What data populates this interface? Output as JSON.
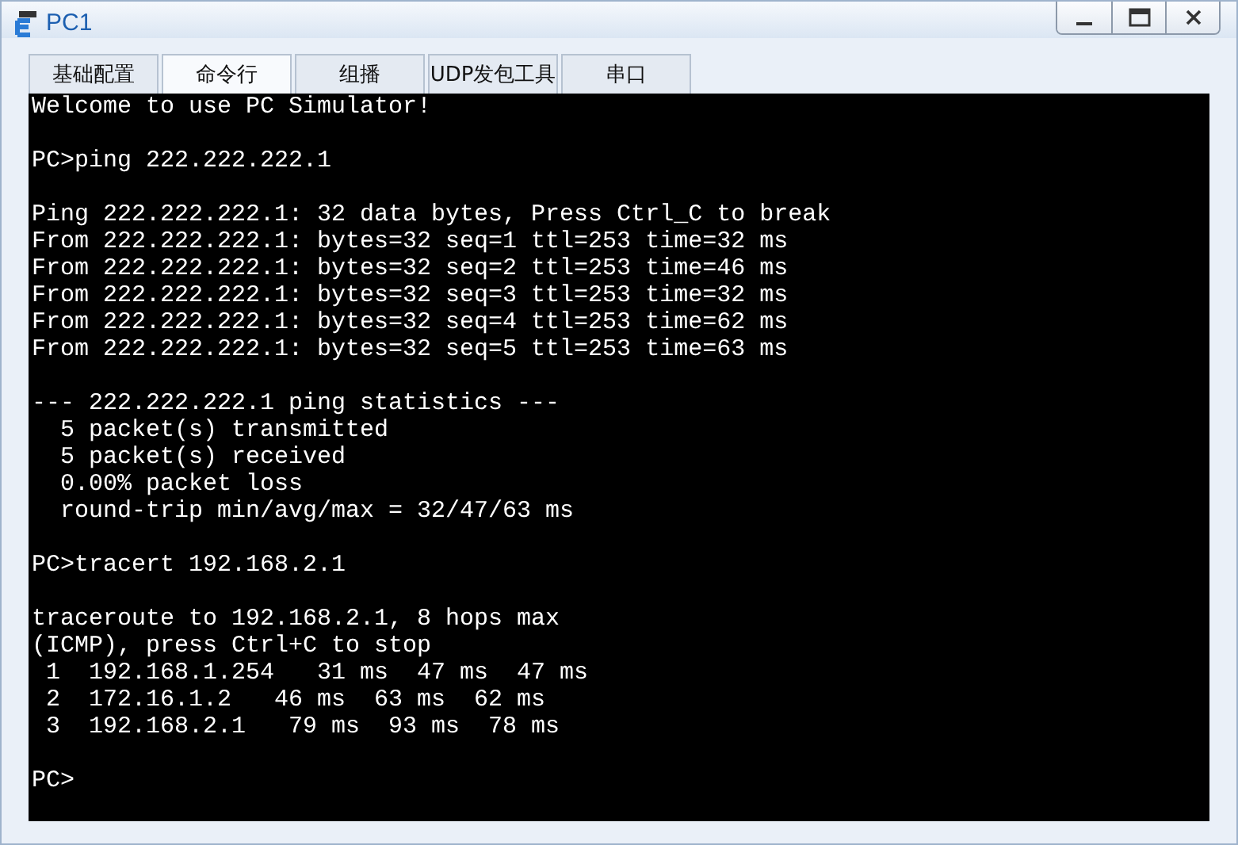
{
  "window": {
    "title": "PC1"
  },
  "tabs": [
    {
      "label": "基础配置",
      "selected": false
    },
    {
      "label": "命令行",
      "selected": true
    },
    {
      "label": "组播",
      "selected": false
    },
    {
      "label": "UDP发包工具",
      "selected": false
    },
    {
      "label": "串口",
      "selected": false
    }
  ],
  "terminal": {
    "blocks": [
      [
        "Welcome to use PC Simulator!"
      ],
      [
        "PC>ping 222.222.222.1"
      ],
      [
        "Ping 222.222.222.1: 32 data bytes, Press Ctrl_C to break",
        "From 222.222.222.1: bytes=32 seq=1 ttl=253 time=32 ms",
        "From 222.222.222.1: bytes=32 seq=2 ttl=253 time=46 ms",
        "From 222.222.222.1: bytes=32 seq=3 ttl=253 time=32 ms",
        "From 222.222.222.1: bytes=32 seq=4 ttl=253 time=62 ms",
        "From 222.222.222.1: bytes=32 seq=5 ttl=253 time=63 ms"
      ],
      [
        "--- 222.222.222.1 ping statistics ---",
        "  5 packet(s) transmitted",
        "  5 packet(s) received",
        "  0.00% packet loss",
        "  round-trip min/avg/max = 32/47/63 ms"
      ],
      [
        "PC>tracert 192.168.2.1"
      ],
      [
        "traceroute to 192.168.2.1, 8 hops max",
        "(ICMP), press Ctrl+C to stop",
        " 1  192.168.1.254   31 ms  47 ms  47 ms",
        " 2  172.16.1.2   46 ms  63 ms  62 ms",
        " 3  192.168.2.1   79 ms  93 ms  78 ms"
      ],
      [
        "PC>"
      ]
    ]
  }
}
